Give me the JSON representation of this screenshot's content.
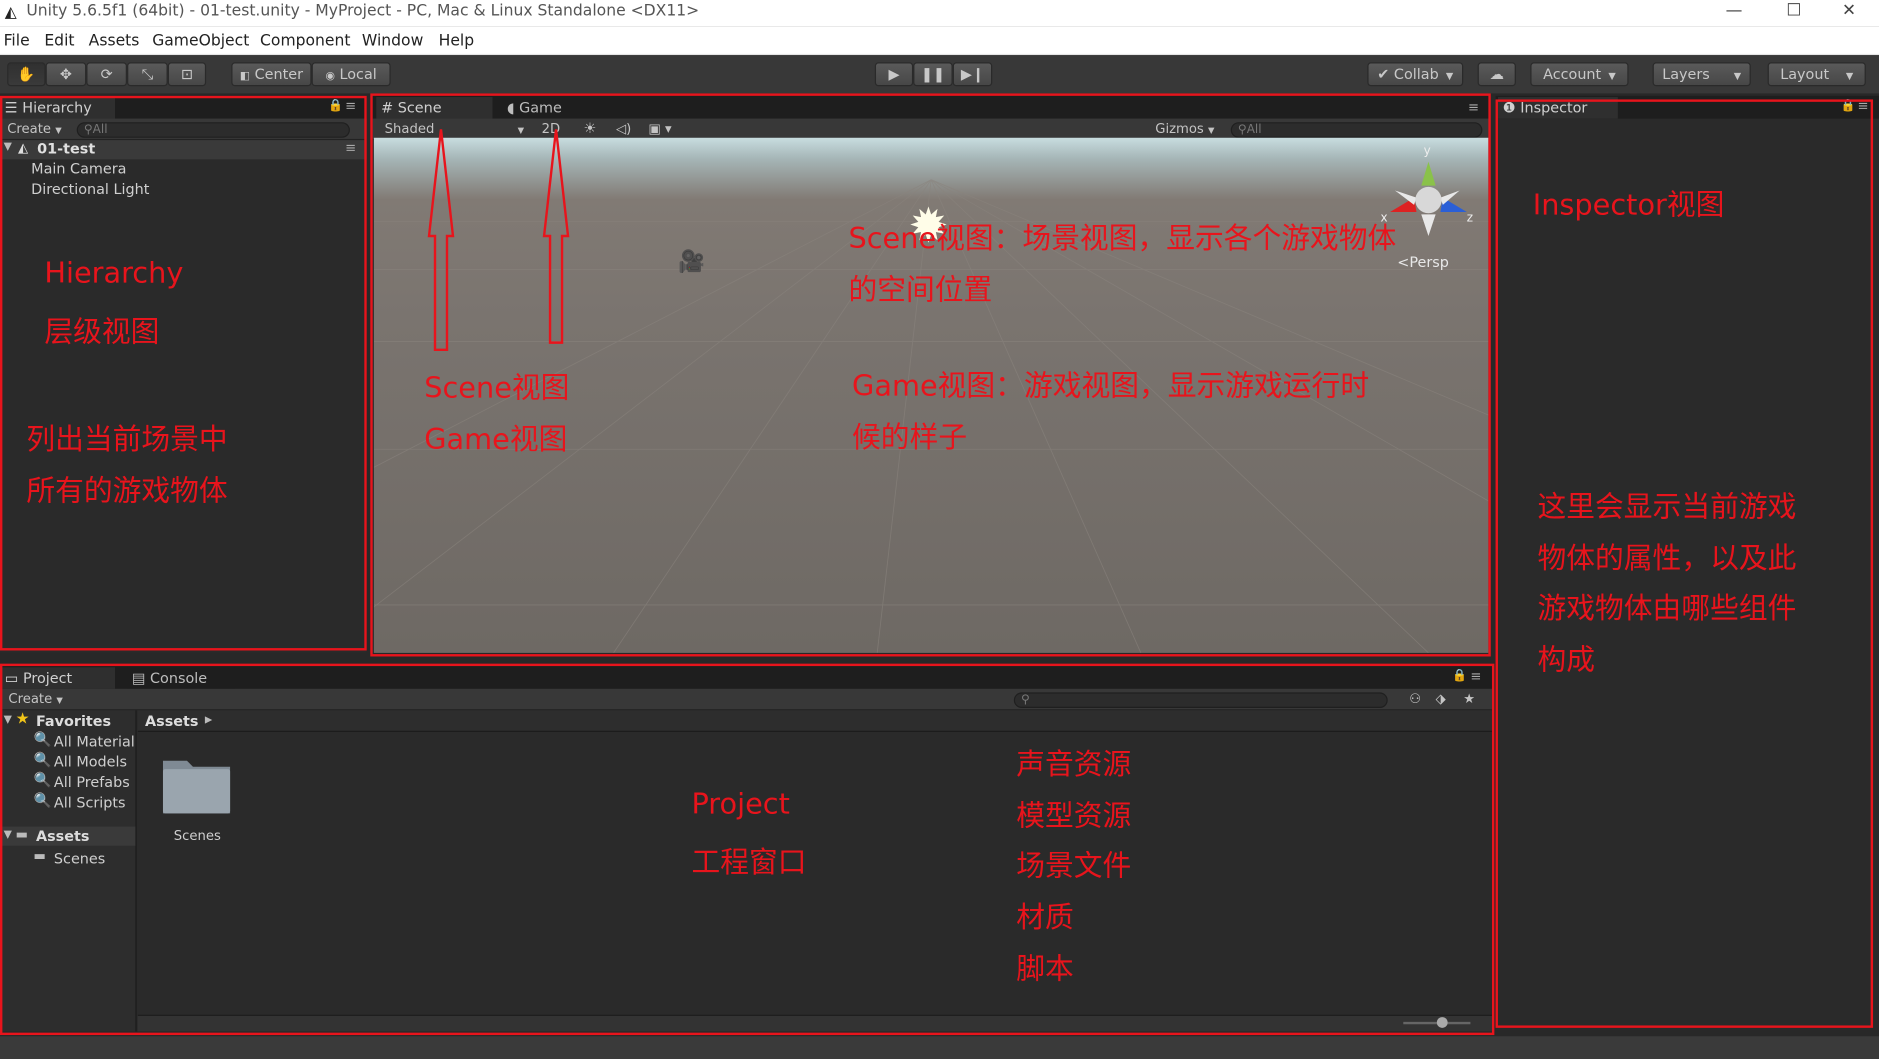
{
  "window": {
    "title": "Unity 5.6.5f1 (64bit) - 01-test.unity - MyProject - PC, Mac & Linux Standalone <DX11>",
    "minimize": "—",
    "maximize": "☐",
    "close": "✕"
  },
  "menu": [
    "File",
    "Edit",
    "Assets",
    "GameObject",
    "Component",
    "Window",
    "Help"
  ],
  "toolbar": {
    "center_label": "Center",
    "local_label": "Local",
    "collab_label": "Collab",
    "account_label": "Account",
    "layers_label": "Layers",
    "layout_label": "Layout"
  },
  "hierarchy": {
    "tab_label": "Hierarchy",
    "create_label": "Create",
    "search_placeholder": "All",
    "scene_name": "01-test",
    "items": [
      "Main Camera",
      "Directional Light"
    ]
  },
  "scene": {
    "scene_tab": "Scene",
    "game_tab": "Game",
    "shaded_label": "Shaded",
    "mode_2d": "2D",
    "gizmos_label": "Gizmos",
    "search_placeholder": "All",
    "persp_label": "Persp",
    "axis_y": "y",
    "axis_z": "z",
    "axis_x": "x"
  },
  "inspector": {
    "tab_label": "Inspector"
  },
  "project": {
    "project_tab": "Project",
    "console_tab": "Console",
    "create_label": "Create",
    "favorites_label": "Favorites",
    "favorites": [
      "All Materials",
      "All Models",
      "All Prefabs",
      "All Scripts"
    ],
    "assets_label": "Assets",
    "asset_children": [
      "Scenes"
    ],
    "breadcrumb": "Assets",
    "folder_name": "Scenes"
  },
  "annotations": {
    "hierarchy_title": "Hierarchy",
    "hierarchy_sub": "层级视图",
    "hierarchy_desc1": "列出当前场景中",
    "hierarchy_desc2": "所有的游戏物体",
    "scene_label": "Scene视图",
    "game_label": "Game视图",
    "scene_desc1": "Scene视图：场景视图，显示各个游戏物体",
    "scene_desc2": "的空间位置",
    "game_desc1": "Game视图：游戏视图，显示游戏运行时",
    "game_desc2": "候的样子",
    "inspector_title": "Inspector视图",
    "inspector_desc1": "这里会显示当前游戏",
    "inspector_desc2": "物体的属性，以及此",
    "inspector_desc3": "游戏物体由哪些组件",
    "inspector_desc4": "构成",
    "project_title": "Project",
    "project_sub": "工程窗口",
    "asset_types": [
      "声音资源",
      "模型资源",
      "场景文件",
      "材质",
      "脚本"
    ]
  },
  "colors": {
    "annotation_red": "#e8141c",
    "panel_bg": "#2a2a2a",
    "toolbar_bg": "#383838"
  }
}
